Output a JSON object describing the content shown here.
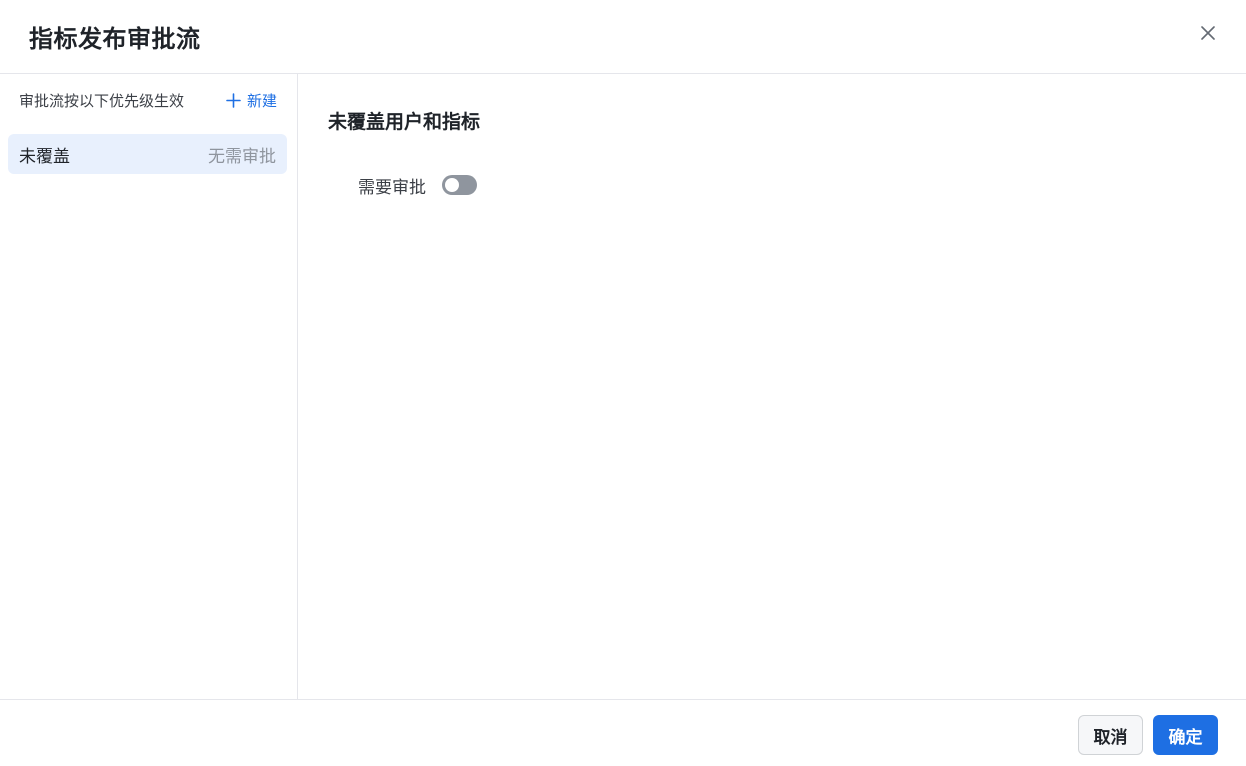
{
  "dialog": {
    "title": "指标发布审批流",
    "close_icon": "close-icon"
  },
  "sidebar": {
    "caption": "审批流按以下优先级生效",
    "new_button": {
      "label": "新建",
      "icon": "plus-icon",
      "color": "#1e6fe3"
    },
    "items": [
      {
        "name": "未覆盖",
        "status": "无需审批",
        "selected": true
      }
    ]
  },
  "main": {
    "section_title": "未覆盖用户和指标",
    "fields": [
      {
        "label": "需要审批",
        "type": "toggle",
        "checked": false
      }
    ]
  },
  "footer": {
    "cancel_label": "取消",
    "confirm_label": "确定"
  },
  "colors": {
    "accent": "#1e6fe3",
    "selected_bg": "#e8f0fd",
    "toggle_off": "#8f959e"
  }
}
